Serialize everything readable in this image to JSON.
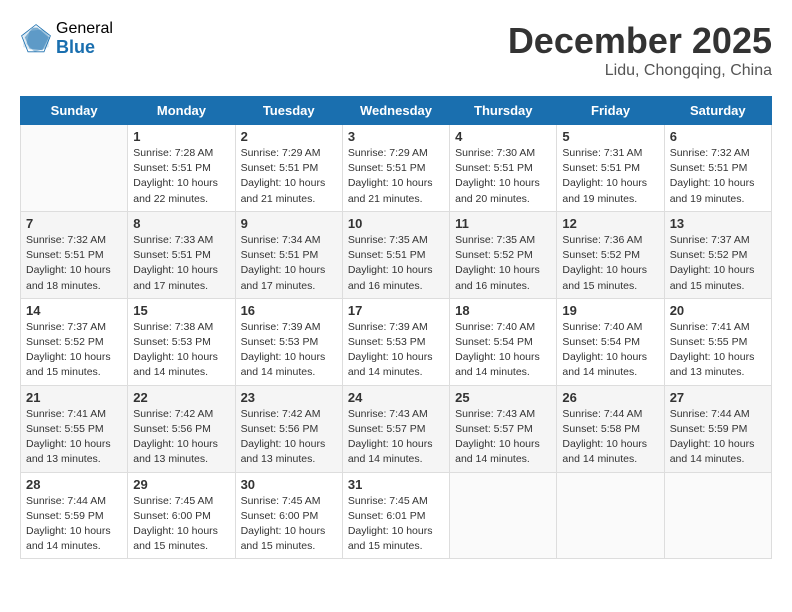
{
  "logo": {
    "general": "General",
    "blue": "Blue"
  },
  "title": "December 2025",
  "location": "Lidu, Chongqing, China",
  "weekdays": [
    "Sunday",
    "Monday",
    "Tuesday",
    "Wednesday",
    "Thursday",
    "Friday",
    "Saturday"
  ],
  "weeks": [
    [
      {
        "day": "",
        "sunrise": "",
        "sunset": "",
        "daylight": ""
      },
      {
        "day": "1",
        "sunrise": "Sunrise: 7:28 AM",
        "sunset": "Sunset: 5:51 PM",
        "daylight": "Daylight: 10 hours and 22 minutes."
      },
      {
        "day": "2",
        "sunrise": "Sunrise: 7:29 AM",
        "sunset": "Sunset: 5:51 PM",
        "daylight": "Daylight: 10 hours and 21 minutes."
      },
      {
        "day": "3",
        "sunrise": "Sunrise: 7:29 AM",
        "sunset": "Sunset: 5:51 PM",
        "daylight": "Daylight: 10 hours and 21 minutes."
      },
      {
        "day": "4",
        "sunrise": "Sunrise: 7:30 AM",
        "sunset": "Sunset: 5:51 PM",
        "daylight": "Daylight: 10 hours and 20 minutes."
      },
      {
        "day": "5",
        "sunrise": "Sunrise: 7:31 AM",
        "sunset": "Sunset: 5:51 PM",
        "daylight": "Daylight: 10 hours and 19 minutes."
      },
      {
        "day": "6",
        "sunrise": "Sunrise: 7:32 AM",
        "sunset": "Sunset: 5:51 PM",
        "daylight": "Daylight: 10 hours and 19 minutes."
      }
    ],
    [
      {
        "day": "7",
        "sunrise": "Sunrise: 7:32 AM",
        "sunset": "Sunset: 5:51 PM",
        "daylight": "Daylight: 10 hours and 18 minutes."
      },
      {
        "day": "8",
        "sunrise": "Sunrise: 7:33 AM",
        "sunset": "Sunset: 5:51 PM",
        "daylight": "Daylight: 10 hours and 17 minutes."
      },
      {
        "day": "9",
        "sunrise": "Sunrise: 7:34 AM",
        "sunset": "Sunset: 5:51 PM",
        "daylight": "Daylight: 10 hours and 17 minutes."
      },
      {
        "day": "10",
        "sunrise": "Sunrise: 7:35 AM",
        "sunset": "Sunset: 5:51 PM",
        "daylight": "Daylight: 10 hours and 16 minutes."
      },
      {
        "day": "11",
        "sunrise": "Sunrise: 7:35 AM",
        "sunset": "Sunset: 5:52 PM",
        "daylight": "Daylight: 10 hours and 16 minutes."
      },
      {
        "day": "12",
        "sunrise": "Sunrise: 7:36 AM",
        "sunset": "Sunset: 5:52 PM",
        "daylight": "Daylight: 10 hours and 15 minutes."
      },
      {
        "day": "13",
        "sunrise": "Sunrise: 7:37 AM",
        "sunset": "Sunset: 5:52 PM",
        "daylight": "Daylight: 10 hours and 15 minutes."
      }
    ],
    [
      {
        "day": "14",
        "sunrise": "Sunrise: 7:37 AM",
        "sunset": "Sunset: 5:52 PM",
        "daylight": "Daylight: 10 hours and 15 minutes."
      },
      {
        "day": "15",
        "sunrise": "Sunrise: 7:38 AM",
        "sunset": "Sunset: 5:53 PM",
        "daylight": "Daylight: 10 hours and 14 minutes."
      },
      {
        "day": "16",
        "sunrise": "Sunrise: 7:39 AM",
        "sunset": "Sunset: 5:53 PM",
        "daylight": "Daylight: 10 hours and 14 minutes."
      },
      {
        "day": "17",
        "sunrise": "Sunrise: 7:39 AM",
        "sunset": "Sunset: 5:53 PM",
        "daylight": "Daylight: 10 hours and 14 minutes."
      },
      {
        "day": "18",
        "sunrise": "Sunrise: 7:40 AM",
        "sunset": "Sunset: 5:54 PM",
        "daylight": "Daylight: 10 hours and 14 minutes."
      },
      {
        "day": "19",
        "sunrise": "Sunrise: 7:40 AM",
        "sunset": "Sunset: 5:54 PM",
        "daylight": "Daylight: 10 hours and 14 minutes."
      },
      {
        "day": "20",
        "sunrise": "Sunrise: 7:41 AM",
        "sunset": "Sunset: 5:55 PM",
        "daylight": "Daylight: 10 hours and 13 minutes."
      }
    ],
    [
      {
        "day": "21",
        "sunrise": "Sunrise: 7:41 AM",
        "sunset": "Sunset: 5:55 PM",
        "daylight": "Daylight: 10 hours and 13 minutes."
      },
      {
        "day": "22",
        "sunrise": "Sunrise: 7:42 AM",
        "sunset": "Sunset: 5:56 PM",
        "daylight": "Daylight: 10 hours and 13 minutes."
      },
      {
        "day": "23",
        "sunrise": "Sunrise: 7:42 AM",
        "sunset": "Sunset: 5:56 PM",
        "daylight": "Daylight: 10 hours and 13 minutes."
      },
      {
        "day": "24",
        "sunrise": "Sunrise: 7:43 AM",
        "sunset": "Sunset: 5:57 PM",
        "daylight": "Daylight: 10 hours and 14 minutes."
      },
      {
        "day": "25",
        "sunrise": "Sunrise: 7:43 AM",
        "sunset": "Sunset: 5:57 PM",
        "daylight": "Daylight: 10 hours and 14 minutes."
      },
      {
        "day": "26",
        "sunrise": "Sunrise: 7:44 AM",
        "sunset": "Sunset: 5:58 PM",
        "daylight": "Daylight: 10 hours and 14 minutes."
      },
      {
        "day": "27",
        "sunrise": "Sunrise: 7:44 AM",
        "sunset": "Sunset: 5:59 PM",
        "daylight": "Daylight: 10 hours and 14 minutes."
      }
    ],
    [
      {
        "day": "28",
        "sunrise": "Sunrise: 7:44 AM",
        "sunset": "Sunset: 5:59 PM",
        "daylight": "Daylight: 10 hours and 14 minutes."
      },
      {
        "day": "29",
        "sunrise": "Sunrise: 7:45 AM",
        "sunset": "Sunset: 6:00 PM",
        "daylight": "Daylight: 10 hours and 15 minutes."
      },
      {
        "day": "30",
        "sunrise": "Sunrise: 7:45 AM",
        "sunset": "Sunset: 6:00 PM",
        "daylight": "Daylight: 10 hours and 15 minutes."
      },
      {
        "day": "31",
        "sunrise": "Sunrise: 7:45 AM",
        "sunset": "Sunset: 6:01 PM",
        "daylight": "Daylight: 10 hours and 15 minutes."
      },
      {
        "day": "",
        "sunrise": "",
        "sunset": "",
        "daylight": ""
      },
      {
        "day": "",
        "sunrise": "",
        "sunset": "",
        "daylight": ""
      },
      {
        "day": "",
        "sunrise": "",
        "sunset": "",
        "daylight": ""
      }
    ]
  ]
}
